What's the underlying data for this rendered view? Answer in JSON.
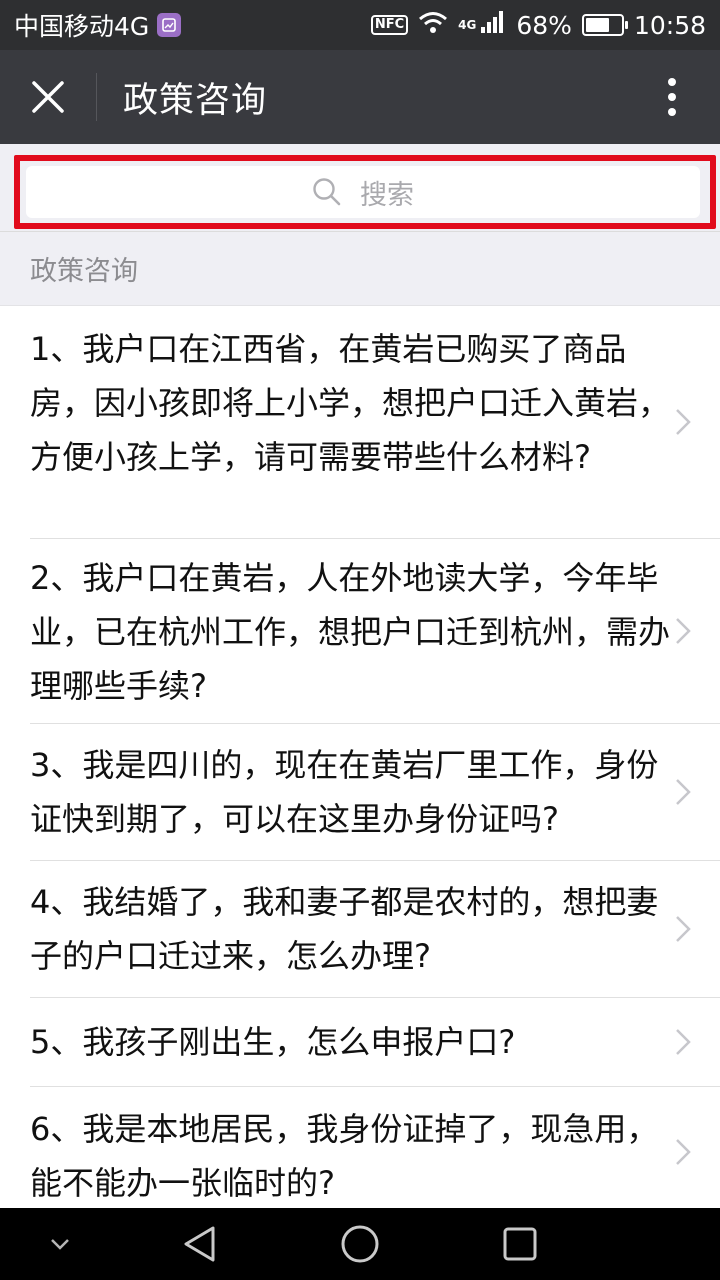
{
  "status_bar": {
    "carrier": "中国移动4G",
    "nfc": "NFC",
    "network": "4G",
    "battery": "68%",
    "battery_level": 0.68,
    "time": "10:58"
  },
  "title_bar": {
    "title": "政策咨询",
    "close_icon": "close-icon",
    "more_icon": "more-vertical-icon"
  },
  "search": {
    "placeholder": "搜索",
    "icon": "search-icon",
    "highlight_color": "#e10b1c"
  },
  "section": {
    "header": "政策咨询"
  },
  "questions": [
    {
      "text": "1、我户口在江西省，在黄岩已购买了商品房，因小孩即将上小学，想把户口迁入黄岩，方便小孩上学，请可需要带些什么材料?"
    },
    {
      "text": "2、我户口在黄岩，人在外地读大学，今年毕业，已在杭州工作，想把户口迁到杭州，需办理哪些手续?"
    },
    {
      "text": "3、我是四川的，现在在黄岩厂里工作，身份证快到期了，可以在这里办身份证吗?"
    },
    {
      "text": "4、我结婚了，我和妻子都是农村的，想把妻子的户口迁过来，怎么办理?"
    },
    {
      "text": "5、我孩子刚出生，怎么申报户口?"
    },
    {
      "text": "6、我是本地居民，我身份证掉了，现急用，能不能办一张临时的?"
    }
  ],
  "nav_bar": {
    "icons": [
      "chevron-down-icon",
      "back-triangle-icon",
      "home-circle-icon",
      "recents-square-icon"
    ]
  },
  "colors": {
    "status_bar_bg": "#2e2f31",
    "title_bar_bg": "#393a3f",
    "page_bg": "#efeff4"
  }
}
